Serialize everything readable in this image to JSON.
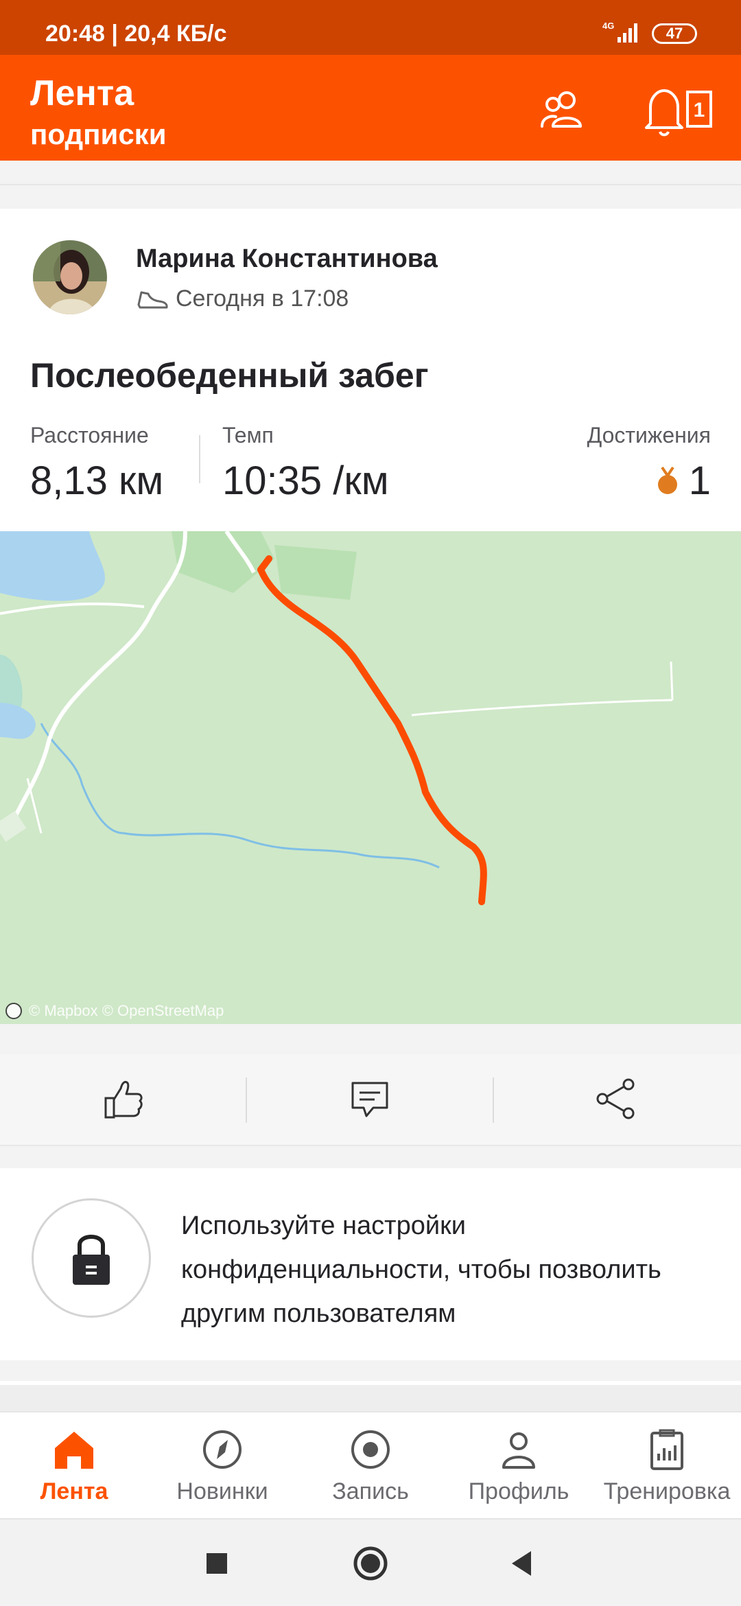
{
  "status_bar": {
    "time": "20:48 | 20,4 КБ/с",
    "network": "4G",
    "battery": "47"
  },
  "header": {
    "title": "Лента",
    "subtitle": "подписки",
    "notification_count": "1"
  },
  "post": {
    "athlete_name": "Марина Константинова",
    "timestamp": "Сегодня в 17:08",
    "activity_title": "Послеобеденный забег",
    "stats": {
      "distance_label": "Расстояние",
      "distance_value": "8,13 км",
      "pace_label": "Темп",
      "pace_value": "10:35 /км",
      "achievements_label": "Достижения",
      "achievements_value": "1"
    },
    "map_attribution": "© Mapbox © OpenStreetMap",
    "route_color": "#fc4c02"
  },
  "privacy_prompt": {
    "text": "Используйте настройки конфиденциальности, чтобы позволить другим пользователям"
  },
  "bottom_nav": {
    "items": [
      {
        "label": "Лента",
        "icon": "home-icon",
        "active": true
      },
      {
        "label": "Новинки",
        "icon": "compass-icon",
        "active": false
      },
      {
        "label": "Запись",
        "icon": "record-icon",
        "active": false
      },
      {
        "label": "Профиль",
        "icon": "profile-icon",
        "active": false
      },
      {
        "label": "Тренировка",
        "icon": "training-icon",
        "active": false
      }
    ]
  },
  "colors": {
    "brand": "#fc5200",
    "status_bar": "#cc4400",
    "map_bg": "#cfe8c8",
    "water": "#aad3f0"
  }
}
